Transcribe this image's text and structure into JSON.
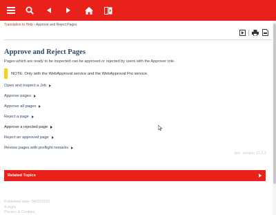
{
  "topbar": {
    "menu_icon": "menu-icon",
    "search_icon": "search-icon",
    "back_icon": "chevron-left-icon",
    "forward_icon": "chevron-right-icon",
    "home_icon": "home-icon",
    "toc_icon": "book-icon",
    "bg_color": "#e8211b"
  },
  "breadcrumb": {
    "link_label": "Translation to Help",
    "separator": "›",
    "current": "Approve and Reject Pages"
  },
  "toolbar": {
    "expand_icon": "expand-icon",
    "print_icon": "print-icon",
    "pdf_icon": "pdf-icon"
  },
  "page": {
    "title": "Approve and Reject Pages",
    "intro": "Pages which are ready to be inspected can be approved or rejected by users with the Approver role.",
    "note": "NOTE: Only with the WebApproval service and the WebApproval Pro service."
  },
  "links": [
    {
      "label": "Open and inspect a Job",
      "visited": false
    },
    {
      "label": "Approve pages",
      "visited": false
    },
    {
      "label": "Approve all pages",
      "visited": false
    },
    {
      "label": "Reject a page",
      "visited": false
    },
    {
      "label": "Approve a rejected page",
      "visited": true
    },
    {
      "label": "Reject an approved page",
      "visited": false
    },
    {
      "label": "Review pages with preflight remarks",
      "visited": false
    }
  ],
  "version": "doc. version 12.3.2",
  "related": {
    "label": "Related Topics"
  },
  "footer": {
    "published": "Published date: 04/22/2021",
    "company": "© Agfa",
    "privacy": "Privacy & Cookies"
  },
  "colors": {
    "accent": "#e8211b",
    "link": "#2c4a6b",
    "note_bar": "#f4d11d"
  }
}
